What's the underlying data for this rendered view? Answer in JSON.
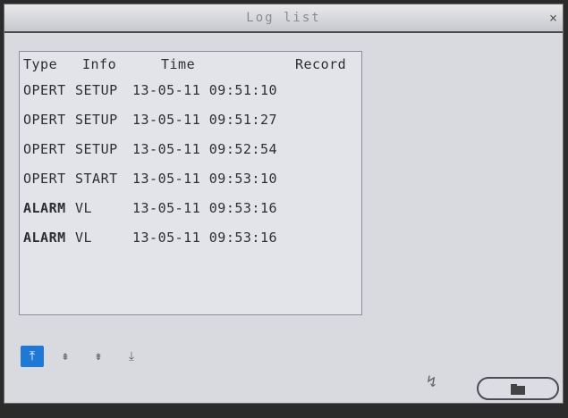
{
  "window": {
    "title": "Log list",
    "close_label": "×"
  },
  "table": {
    "headers": {
      "type": "Type",
      "info": "Info",
      "time": "Time",
      "record": "Record"
    },
    "rows": [
      {
        "type": "OPERT",
        "info": "SETUP",
        "time": "13-05-11 09:51:10"
      },
      {
        "type": "OPERT",
        "info": "SETUP",
        "time": "13-05-11 09:51:27"
      },
      {
        "type": "OPERT",
        "info": "SETUP",
        "time": "13-05-11 09:52:54"
      },
      {
        "type": "OPERT",
        "info": "START",
        "time": "13-05-11 09:53:10"
      },
      {
        "type": "ALARM",
        "info": "VL",
        "time": "13-05-11 09:53:16"
      },
      {
        "type": "ALARM",
        "info": "VL",
        "time": "13-05-11 09:53:16"
      }
    ]
  },
  "pager": {
    "buttons": [
      {
        "name": "first-page-button",
        "icon": "first-page-icon",
        "active": true
      },
      {
        "name": "prev-page-button",
        "icon": "up-arrow-icon",
        "active": false
      },
      {
        "name": "next-page-button",
        "icon": "down-arrow-icon",
        "active": false
      },
      {
        "name": "last-page-button",
        "icon": "last-page-icon",
        "active": false
      }
    ]
  },
  "colors": {
    "accent": "#1d78d6",
    "window_bg": "#d9dadf",
    "text": "#2d2d34"
  }
}
